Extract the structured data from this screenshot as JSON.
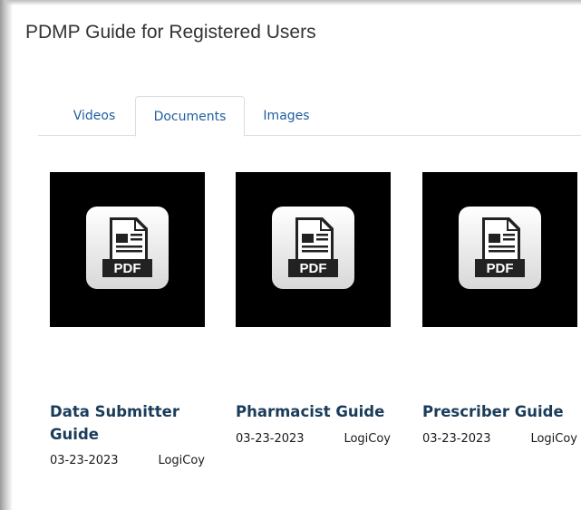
{
  "page": {
    "title": "PDMP Guide for Registered Users"
  },
  "tabs": [
    {
      "label": "Videos",
      "active": false
    },
    {
      "label": "Documents",
      "active": true
    },
    {
      "label": "Images",
      "active": false
    }
  ],
  "documents": [
    {
      "title": "Data Submitter Guide",
      "date": "03-23-2023",
      "author": "LogiCoy",
      "icon": "pdf-file-icon",
      "icon_text": "PDF"
    },
    {
      "title": "Pharmacist Guide",
      "date": "03-23-2023",
      "author": "LogiCoy",
      "icon": "pdf-file-icon",
      "icon_text": "PDF"
    },
    {
      "title": "Prescriber Guide",
      "date": "03-23-2023",
      "author": "LogiCoy",
      "icon": "pdf-file-icon",
      "icon_text": "PDF"
    }
  ],
  "colors": {
    "tab_text": "#1f5fa0",
    "card_title": "#1a3c5a",
    "thumbnail_bg": "#000000"
  }
}
